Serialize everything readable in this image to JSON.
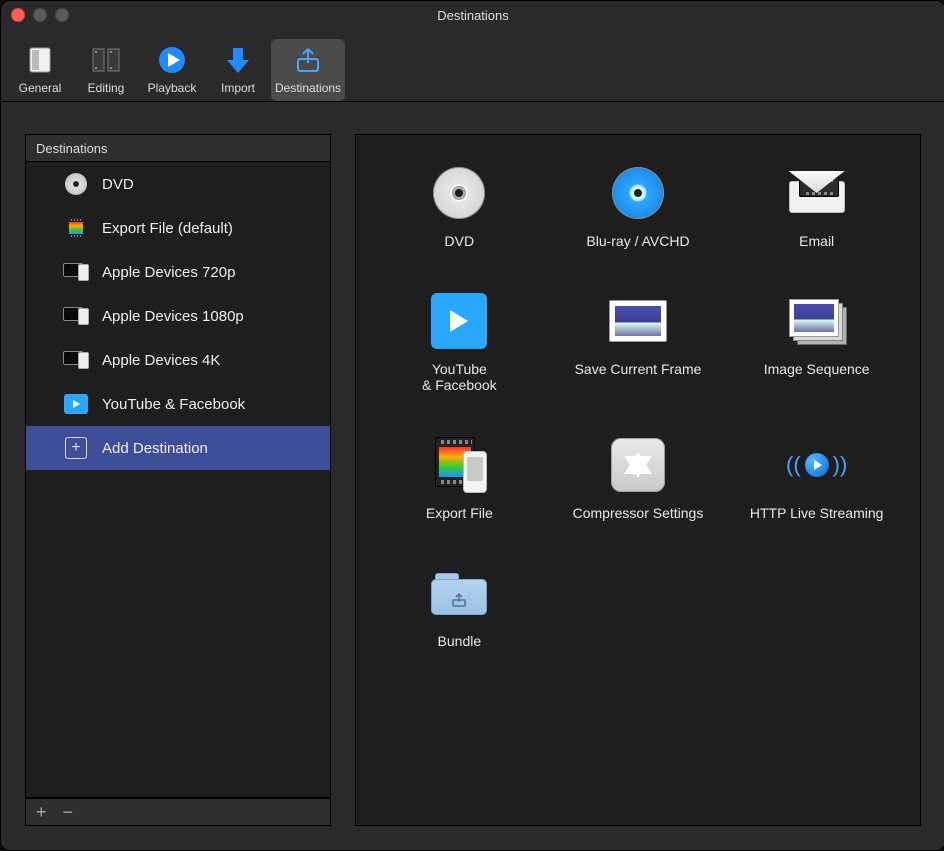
{
  "window": {
    "title": "Destinations"
  },
  "toolbar": {
    "items": [
      {
        "id": "general",
        "label": "General"
      },
      {
        "id": "editing",
        "label": "Editing"
      },
      {
        "id": "playback",
        "label": "Playback"
      },
      {
        "id": "import",
        "label": "Import"
      },
      {
        "id": "destinations",
        "label": "Destinations",
        "selected": true
      }
    ]
  },
  "sidebar": {
    "header": "Destinations",
    "items": [
      {
        "id": "dvd",
        "label": "DVD",
        "icon": "disc"
      },
      {
        "id": "export",
        "label": "Export File (default)",
        "icon": "film"
      },
      {
        "id": "a720",
        "label": "Apple Devices 720p",
        "icon": "devices"
      },
      {
        "id": "a1080",
        "label": "Apple Devices 1080p",
        "icon": "devices"
      },
      {
        "id": "a4k",
        "label": "Apple Devices 4K",
        "icon": "devices"
      },
      {
        "id": "ytfb",
        "label": "YouTube & Facebook",
        "icon": "ytfb"
      },
      {
        "id": "add",
        "label": "Add Destination",
        "icon": "add",
        "selected": true
      }
    ],
    "footer": {
      "plus": "+",
      "minus": "−"
    }
  },
  "grid": {
    "items": [
      {
        "id": "dvd",
        "label": "DVD",
        "icon": "dvd"
      },
      {
        "id": "bluray",
        "label": "Blu-ray / AVCHD",
        "icon": "bluray"
      },
      {
        "id": "email",
        "label": "Email",
        "icon": "email"
      },
      {
        "id": "ytfb",
        "label": "YouTube\n& Facebook",
        "icon": "ytfb"
      },
      {
        "id": "saveframe",
        "label": "Save Current Frame",
        "icon": "frame"
      },
      {
        "id": "imgseq",
        "label": "Image Sequence",
        "icon": "imgseq"
      },
      {
        "id": "exportfile",
        "label": "Export File",
        "icon": "exportfile"
      },
      {
        "id": "compressor",
        "label": "Compressor Settings",
        "icon": "compressor"
      },
      {
        "id": "hls",
        "label": "HTTP Live Streaming",
        "icon": "hls"
      },
      {
        "id": "bundle",
        "label": "Bundle",
        "icon": "bundle"
      }
    ]
  }
}
